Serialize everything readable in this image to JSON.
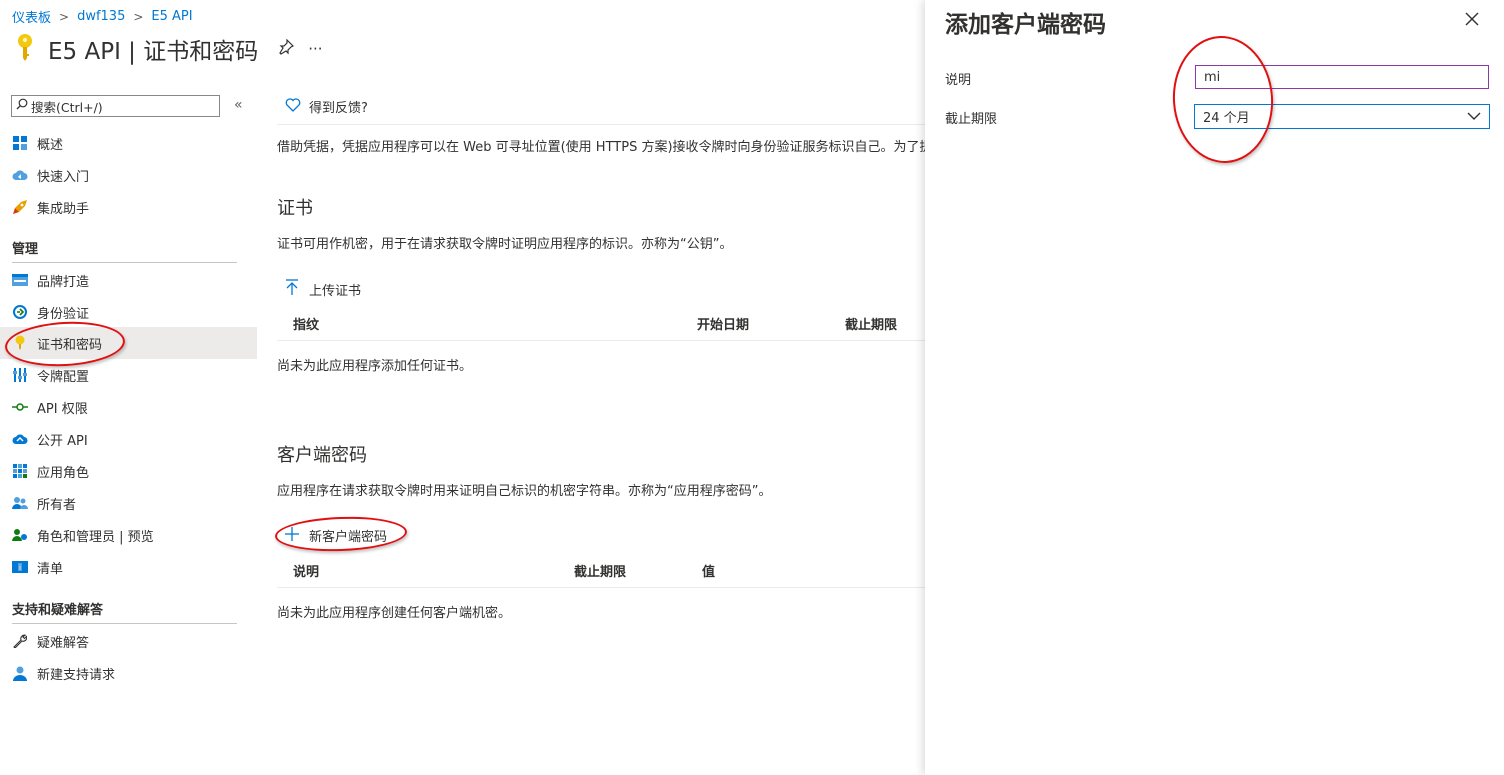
{
  "breadcrumb": {
    "item1": "仪表板",
    "item2": "dwf135",
    "item3": "E5 API"
  },
  "page": {
    "title": "E5 API | 证书和密码",
    "more": "···"
  },
  "sidebar": {
    "search_placeholder": "搜索(Ctrl+/)",
    "items_top": [
      {
        "label": "概述"
      },
      {
        "label": "快速入门"
      },
      {
        "label": "集成助手"
      }
    ],
    "section_manage": "管理",
    "items_manage": [
      {
        "label": "品牌打造"
      },
      {
        "label": "身份验证"
      },
      {
        "label": "证书和密码"
      },
      {
        "label": "令牌配置"
      },
      {
        "label": "API 权限"
      },
      {
        "label": "公开 API"
      },
      {
        "label": "应用角色"
      },
      {
        "label": "所有者"
      },
      {
        "label": "角色和管理员 | 预览"
      },
      {
        "label": "清单"
      }
    ],
    "section_support": "支持和疑难解答",
    "items_support": [
      {
        "label": "疑难解答"
      },
      {
        "label": "新建支持请求"
      }
    ]
  },
  "main": {
    "feedback": "得到反馈?",
    "intro": "借助凭据，凭据应用程序可以在 Web 可寻址位置(使用 HTTPS 方案)接收令牌时向身份验证服务标识自己。为了提高",
    "certs": {
      "heading": "证书",
      "desc": "证书可用作机密，用于在请求获取令牌时证明应用程序的标识。亦称为“公钥”。",
      "upload": "上传证书",
      "col1": "指纹",
      "col2": "开始日期",
      "col3": "截止期限",
      "empty": "尚未为此应用程序添加任何证书。"
    },
    "secrets": {
      "heading": "客户端密码",
      "desc": "应用程序在请求获取令牌时用来证明自己标识的机密字符串。亦称为“应用程序密码”。",
      "new": "新客户端密码",
      "col1": "说明",
      "col2": "截止期限",
      "col3": "值",
      "empty": "尚未为此应用程序创建任何客户端机密。"
    }
  },
  "panel": {
    "title": "添加客户端密码",
    "desc_label": "说明",
    "desc_value": "mi",
    "expiry_label": "截止期限",
    "expiry_value": "24 个月"
  },
  "colors": {
    "accent": "#0078d4",
    "annotation": "#e01010",
    "key_yellow": "#f2c811"
  }
}
